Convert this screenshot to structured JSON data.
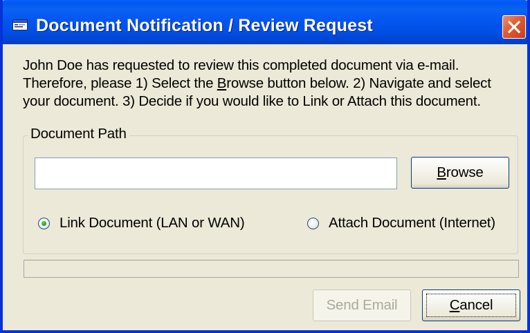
{
  "window": {
    "title": "Document Notification / Review Request"
  },
  "description": {
    "line1": "John Doe has requested to review this completed document via e-mail.",
    "line2_before": "Therefore, please 1) Select the ",
    "line2_accel": "B",
    "line2_after": "rowse button below. 2) Navigate and select",
    "line3": "your document. 3) Decide if you would like to Link or Attach this document."
  },
  "document_path": {
    "group_label": "Document Path",
    "value": "",
    "browse_accel": "B",
    "browse_rest": "rowse"
  },
  "options": {
    "link_label": "Link Document (LAN or WAN)",
    "link_selected": true,
    "attach_label": "Attach Document (Internet)",
    "attach_selected": false
  },
  "status": {
    "text": ""
  },
  "footer": {
    "send_label": "Send Email",
    "send_enabled": false,
    "cancel_accel": "C",
    "cancel_rest": "ancel"
  },
  "colors": {
    "titlebar": "#0054e3",
    "window_bg": "#ece9d8",
    "close_button": "#e15a31",
    "radio_dot": "#21a121"
  },
  "icons": {
    "title": "window-app-icon",
    "close": "close-x-icon"
  }
}
